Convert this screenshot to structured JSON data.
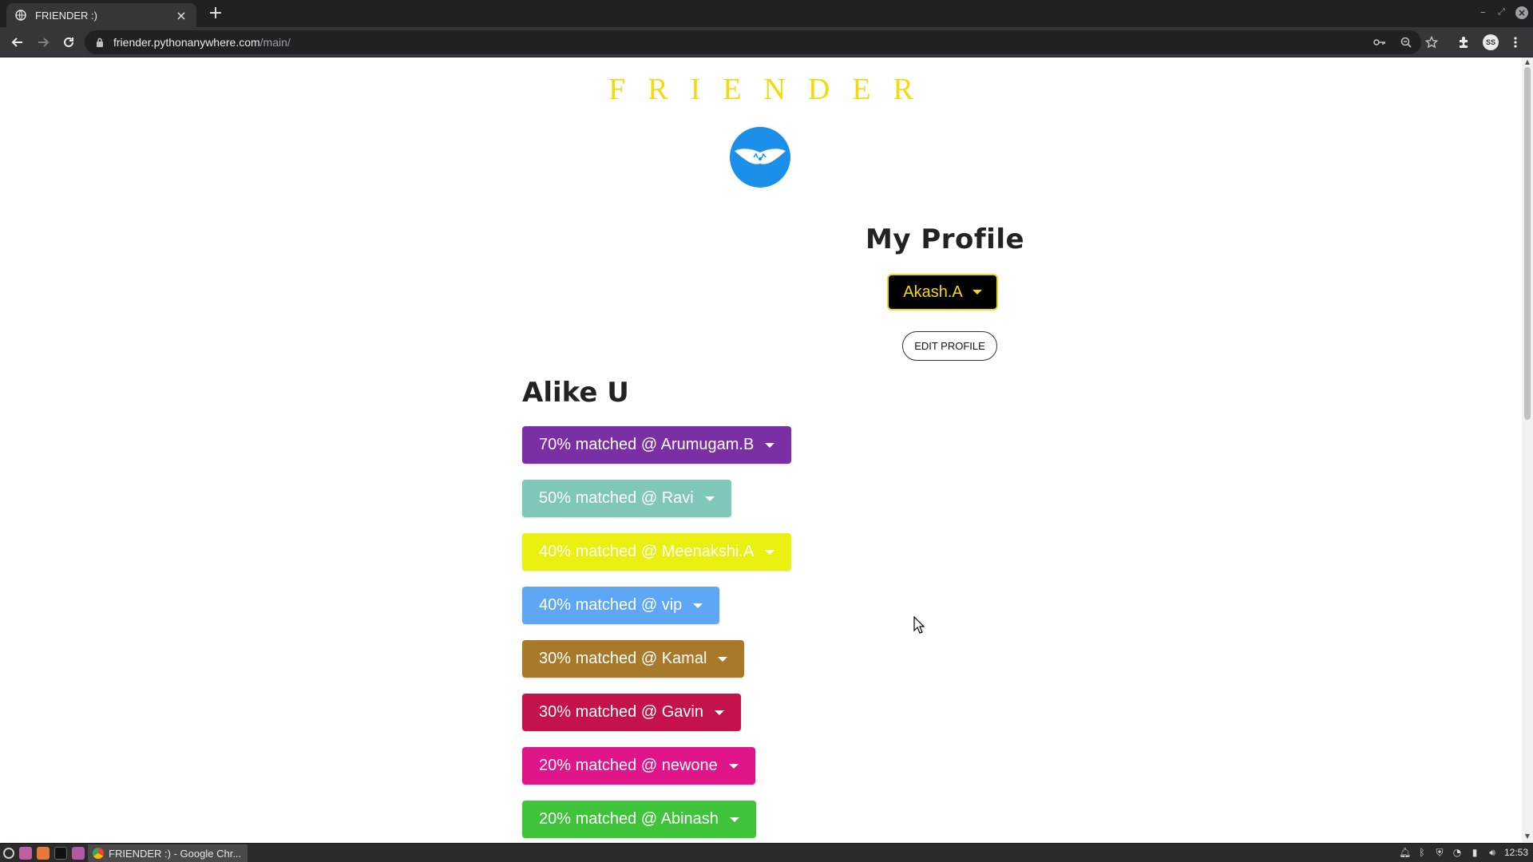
{
  "browser": {
    "tab_title": "FRIENDER :)",
    "url_host": "friender.pythonanywhere.com",
    "url_path": "/main/",
    "profile_initials": "SS",
    "icons": [
      "back-icon",
      "forward-icon",
      "reload-icon",
      "lock-icon",
      "key-icon",
      "zoom-icon",
      "star-icon",
      "extensions-icon",
      "menu-icon"
    ]
  },
  "page": {
    "brand": "FRIENDER",
    "brand_color": "#f5d90a",
    "profile_heading": "My Profile",
    "username": "Akash.A",
    "edit_profile_label": "EDIT PROFILE",
    "alike_heading": "Alike U",
    "matches": [
      {
        "label": "70% matched @ Arumugam.B",
        "color": "#7b2fa5"
      },
      {
        "label": "50% matched @ Ravi",
        "color": "#7fc8b9"
      },
      {
        "label": "40% matched @ Meenakshi.A",
        "color": "#eaf010"
      },
      {
        "label": "40% matched @ vip",
        "color": "#5ea7f5"
      },
      {
        "label": "30% matched @ Kamal",
        "color": "#a8782b"
      },
      {
        "label": "30% matched @ Gavin",
        "color": "#c4124a"
      },
      {
        "label": "20% matched @ newone",
        "color": "#e0158a"
      },
      {
        "label": "20% matched @ Abinash",
        "color": "#3fc33a"
      }
    ]
  },
  "taskbar": {
    "task_title": "FRIENDER :) - Google Chr...",
    "clock": "12:53"
  }
}
